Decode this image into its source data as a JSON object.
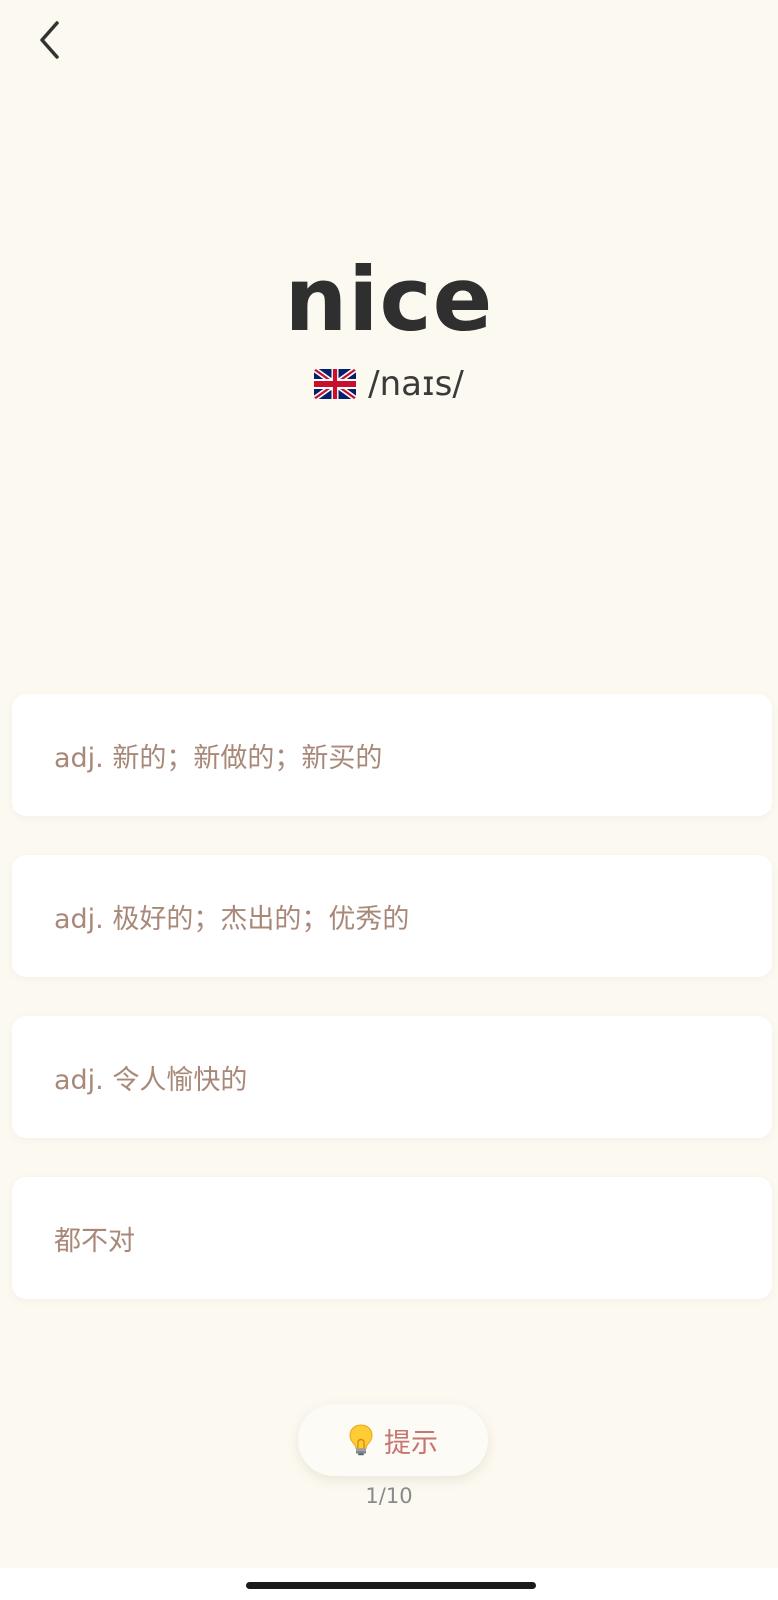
{
  "header": {
    "back_icon": "chevron-left-icon"
  },
  "word": {
    "text": "nice",
    "accent_flag": "uk-flag-icon",
    "phonetic": "/naɪs/"
  },
  "options": [
    {
      "label": "adj. 新的；新做的；新买的"
    },
    {
      "label": "adj. 极好的；杰出的；优秀的"
    },
    {
      "label": "adj. 令人愉快的"
    },
    {
      "label": "都不对"
    }
  ],
  "hint": {
    "icon": "lightbulb-icon",
    "label": "提示"
  },
  "progress": {
    "text": "1/10",
    "current": 1,
    "total": 10
  },
  "colors": {
    "background": "#fcf9f1",
    "option_text": "#a88878",
    "hint_text": "#c77570",
    "word_text": "#2f2f2f"
  }
}
